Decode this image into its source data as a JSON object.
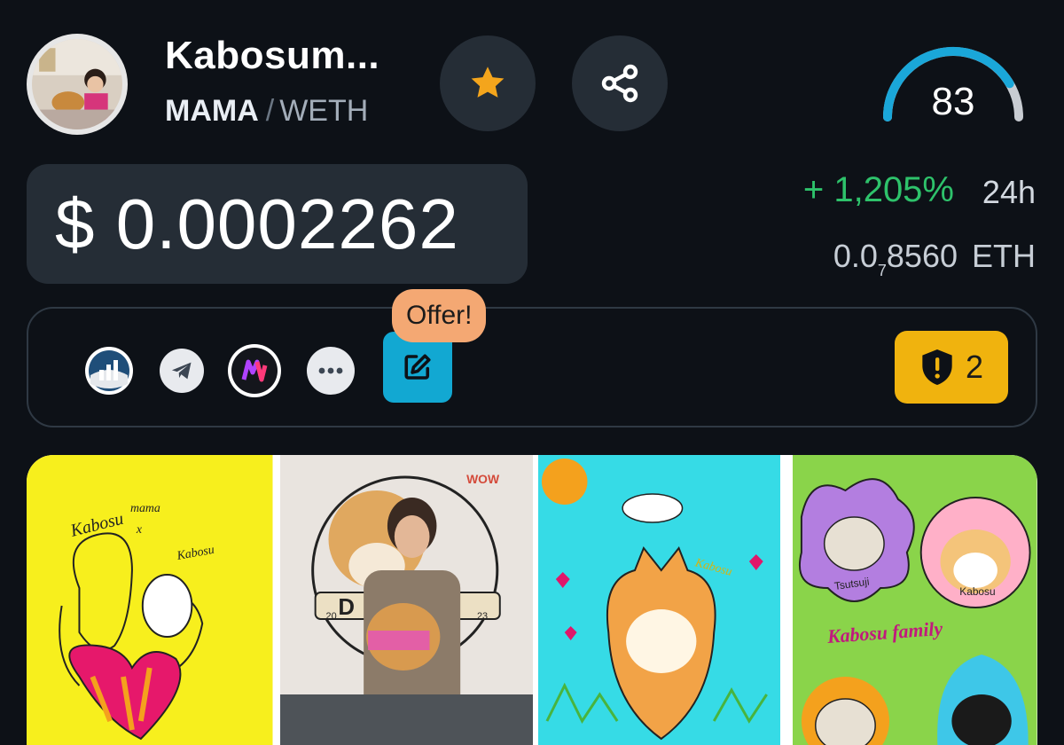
{
  "token": {
    "name": "Kabosum...",
    "base_symbol": "MAMA",
    "separator": "/",
    "quote_symbol": "WETH"
  },
  "score": {
    "value": "83",
    "fraction": 0.83
  },
  "price": {
    "usd": "$ 0.0002262",
    "change": "+ 1,205%",
    "change_period": "24h",
    "eth_prefix": "0.0",
    "eth_zero_count": "7",
    "eth_digits": "8560",
    "eth_unit": "ETH"
  },
  "links": {
    "offer_badge": "Offer!",
    "audit_count": "2",
    "items": [
      "chart-site-icon",
      "telegram-icon",
      "app-logo-icon",
      "more-icon"
    ]
  },
  "gallery": {
    "thumb1_text": [
      "Kabosu",
      "mama",
      "x",
      "Kabosu"
    ],
    "thumb2_text": [
      "WOW",
      "D",
      "20",
      "23"
    ],
    "thumb3_text": [
      "Kabosu"
    ],
    "thumb4_text": [
      "Tsutsuji",
      "Kabosu",
      "Kabosu family"
    ]
  },
  "colors": {
    "background": "#0d1117",
    "card": "#252d36",
    "positive": "#2ec26b",
    "star": "#f4a51c",
    "gauge": "#1aa7d9",
    "offer": "#f4a873",
    "edit": "#12a8d2",
    "audit": "#f0b30e"
  }
}
